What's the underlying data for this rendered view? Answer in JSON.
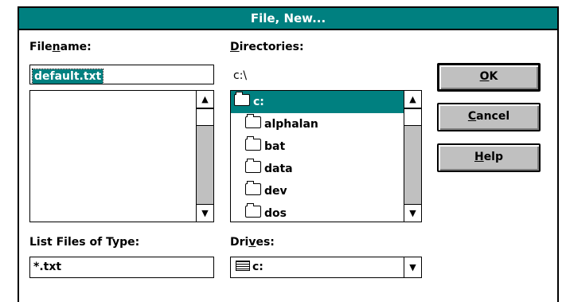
{
  "title": "File, New...",
  "filename": {
    "label_pre": "File",
    "label_u": "n",
    "label_post": "ame:",
    "value": "default.txt"
  },
  "directories": {
    "label_pre": "",
    "label_u": "D",
    "label_post": "irectories:",
    "path": "c:\\",
    "items": [
      {
        "name": "c:",
        "icon": "open-folder-icon",
        "selected": true
      },
      {
        "name": "alphalan",
        "icon": "folder-icon"
      },
      {
        "name": "bat",
        "icon": "folder-icon"
      },
      {
        "name": "data",
        "icon": "folder-icon"
      },
      {
        "name": "dev",
        "icon": "folder-icon"
      },
      {
        "name": "dos",
        "icon": "folder-icon"
      }
    ]
  },
  "file_type": {
    "label": "List Files of Type:",
    "value": "*.txt"
  },
  "drives": {
    "label_pre": "Dri",
    "label_u": "v",
    "label_post": "es:",
    "value": "c:"
  },
  "buttons": {
    "ok": {
      "pre": "",
      "u": "O",
      "post": "K"
    },
    "cancel": {
      "pre": "",
      "u": "C",
      "post": "ancel"
    },
    "help": {
      "pre": "",
      "u": "H",
      "post": "elp"
    }
  },
  "glyphs": {
    "up": "▲",
    "down": "▼",
    "dropdown": "▼"
  },
  "colors": {
    "titlebar": "#008080",
    "selection": "#008080",
    "button_face": "#c0c0c0"
  }
}
